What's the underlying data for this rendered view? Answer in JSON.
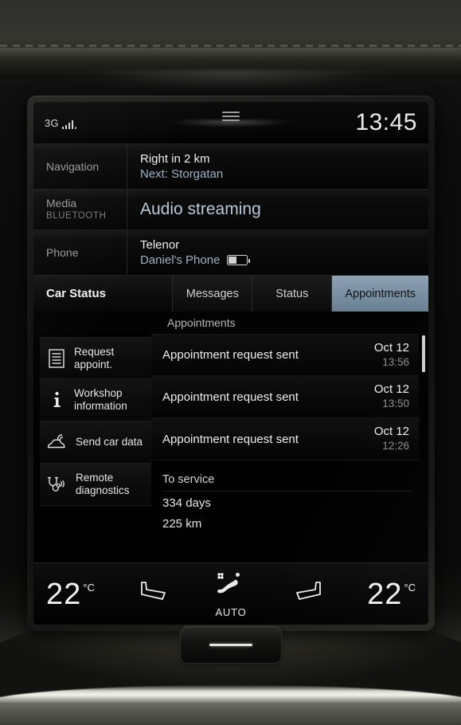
{
  "statusbar": {
    "network": "3G",
    "signal_icon": "signal-bars-icon",
    "handle_icon": "drag-handle-icon",
    "clock": "13:45"
  },
  "tiles": [
    {
      "label": "Navigation",
      "sublabel": "",
      "line1": "Right in 2 km",
      "line2": "Next: Storgatan"
    },
    {
      "label": "Media",
      "sublabel": "BLUETOOTH",
      "line1": "Audio streaming",
      "line2": ""
    },
    {
      "label": "Phone",
      "sublabel": "",
      "line1": "Telenor",
      "line2": "Daniel's Phone",
      "battery_icon": "battery-icon",
      "battery_percent": 40
    }
  ],
  "car_status": {
    "title": "Car Status",
    "tabs": [
      {
        "label": "Messages",
        "active": false
      },
      {
        "label": "Status",
        "active": false
      },
      {
        "label": "Appointments",
        "active": true
      }
    ],
    "list_header": "Appointments",
    "menu": [
      {
        "label_line1": "Request",
        "label_line2": "appoint.",
        "icon": "document-lines-icon"
      },
      {
        "label_line1": "Workshop",
        "label_line2": "information",
        "icon": "info-i-icon"
      },
      {
        "label_line1": "Send car data",
        "label_line2": "",
        "icon": "car-signal-icon"
      },
      {
        "label_line1": "Remote",
        "label_line2": "diagnostics",
        "icon": "stethoscope-signal-icon"
      }
    ],
    "appointments": [
      {
        "message": "Appointment request sent",
        "date": "Oct 12",
        "time": "13:56"
      },
      {
        "message": "Appointment request sent",
        "date": "Oct 12",
        "time": "13:50"
      },
      {
        "message": "Appointment request sent",
        "date": "Oct 12",
        "time": "12:26"
      }
    ],
    "service": {
      "title": "To service",
      "days": "334 days",
      "distance": "225 km"
    }
  },
  "climate": {
    "left_temp": "22",
    "left_unit": "°C",
    "right_temp": "22",
    "right_unit": "°C",
    "left_seat_icon": "seat-icon",
    "right_seat_icon": "seat-icon",
    "fan_icon": "fan-auto-icon",
    "fan_label": "AUTO"
  },
  "hardware": {
    "home_button_icon": "home-dash-icon"
  },
  "colors": {
    "accent_tab": "#7c90a3",
    "text_primary": "#efefef",
    "text_secondary": "#9a9a9a",
    "link_blue": "#9fb2c4",
    "screen_bg": "#000000"
  }
}
